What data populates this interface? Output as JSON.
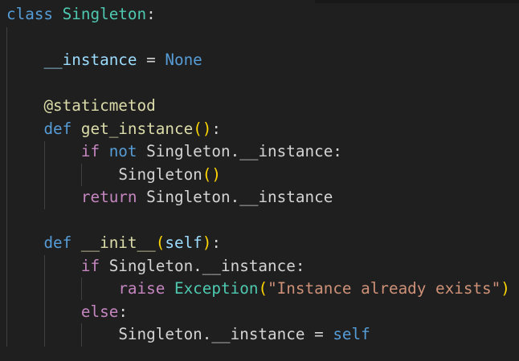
{
  "code": {
    "l1": {
      "t0": "class",
      "t1": " ",
      "t2": "Singleton",
      "t3": ":"
    },
    "l3": {
      "indent": "    ",
      "t0": "__instance",
      "t1": " = ",
      "t2": "None"
    },
    "l5": {
      "indent": "    ",
      "t0": "@staticmetod"
    },
    "l6": {
      "indent": "    ",
      "t0": "def",
      "t1": " ",
      "t2": "get_instance",
      "t3": "()",
      "t4": ":"
    },
    "l7": {
      "indent": "        ",
      "t0": "if",
      "t1": " ",
      "t2": "not",
      "t3": " Singleton.__instance:"
    },
    "l8": {
      "indent": "            ",
      "t0": "Singleton",
      "t1": "()"
    },
    "l9": {
      "indent": "        ",
      "t0": "return",
      "t1": " Singleton.__instance"
    },
    "l11": {
      "indent": "    ",
      "t0": "def",
      "t1": " ",
      "t2": "__init__",
      "t3": "(",
      "t4": "self",
      "t5": ")",
      "t6": ":"
    },
    "l12": {
      "indent": "        ",
      "t0": "if",
      "t1": " Singleton.__instance:"
    },
    "l13": {
      "indent": "            ",
      "t0": "raise",
      "t1": " ",
      "t2": "Exception",
      "t3": "(",
      "t4": "\"Instance already exists\"",
      "t5": ")"
    },
    "l14": {
      "indent": "        ",
      "t0": "else",
      "t1": ":"
    },
    "l15": {
      "indent": "            ",
      "t0": "Singleton.__instance = ",
      "t1": "self"
    }
  },
  "colors": {
    "background": "#1f1f1f",
    "keyword": "#569cd6",
    "control_keyword": "#c586c0",
    "class_name": "#4ec9b0",
    "function_name": "#dcdcaa",
    "variable": "#9cdcfe",
    "string": "#ce9178",
    "bracket": "#ffd700"
  }
}
